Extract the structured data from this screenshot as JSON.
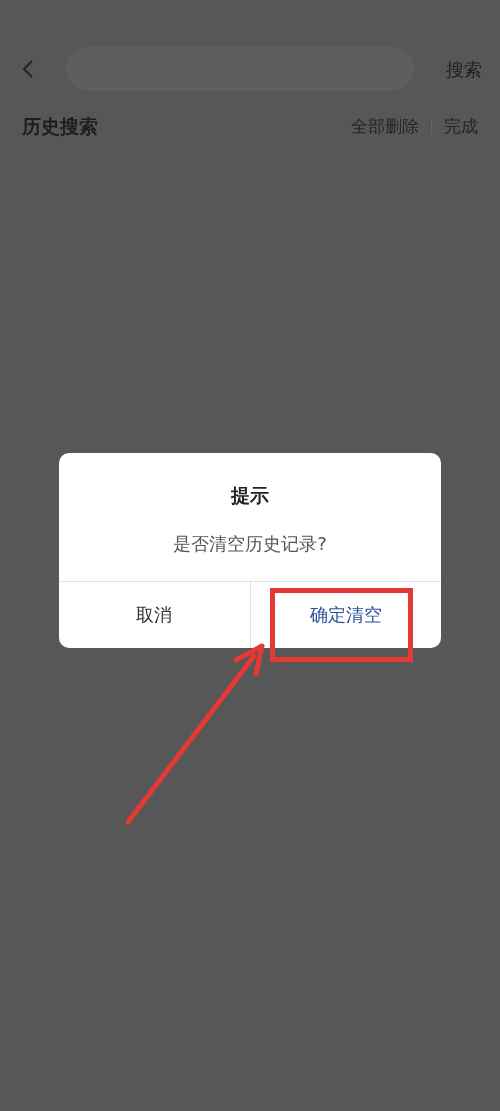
{
  "header": {
    "search_button": "搜索"
  },
  "history": {
    "title": "历史搜索",
    "delete_all": "全部删除",
    "done": "完成"
  },
  "dialog": {
    "title": "提示",
    "message": "是否清空历史记录?",
    "buttons": [
      {
        "label": "取消",
        "kind": "cancel"
      },
      {
        "label": "确定清空",
        "kind": "confirm"
      }
    ]
  }
}
